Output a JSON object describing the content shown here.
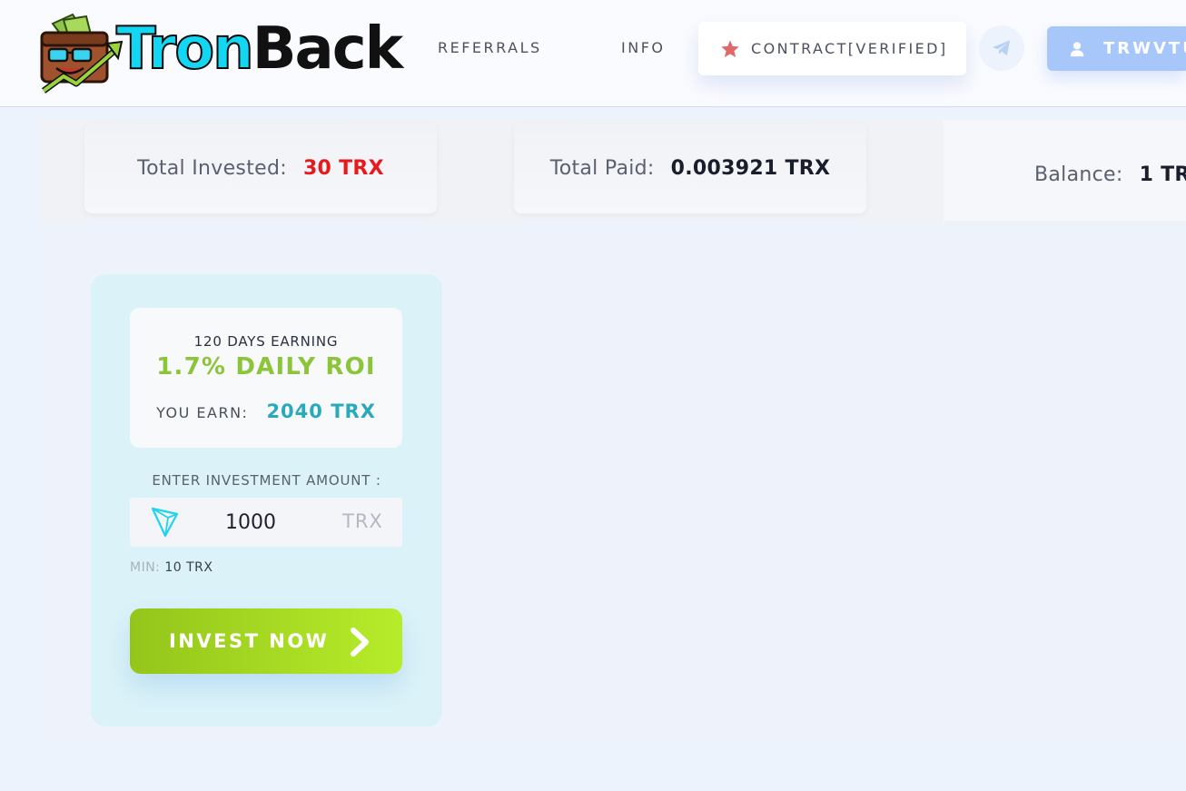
{
  "header": {
    "logo": {
      "part1": "Tron",
      "part2": "Back"
    },
    "nav": {
      "referrals": "REFERRALS",
      "info": "INFO",
      "contract": "CONTRACT[VERIFIED]"
    },
    "account_label": "TRWVTU"
  },
  "stats": {
    "total_invested": {
      "label": "Total Invested:",
      "value": "30 TRX",
      "color": "#e8191d"
    },
    "total_paid": {
      "label": "Total Paid:",
      "value": "0.003921 TRX",
      "color": "#1a1d2b"
    },
    "balance": {
      "label": "Balance:",
      "value": "1 TR",
      "color": "#1a1d2b"
    }
  },
  "plan": {
    "days_label": "120 DAYS EARNING",
    "roi_label": "1.7% DAILY ROI",
    "you_earn_label": "YOU EARN:",
    "you_earn_value": "2040 TRX",
    "enter_label": "ENTER INVESTMENT AMOUNT :",
    "amount_value": "1000",
    "amount_unit": "TRX",
    "min_label": "MIN:",
    "min_value": "10 TRX",
    "invest_button": "INVEST NOW"
  },
  "colors": {
    "accent_cyan": "#13d6f2",
    "roi_green": "#8cc43a",
    "earn_teal": "#28a9bc",
    "button_green": "#a3d621",
    "account_blue": "#a7c7fb",
    "star_red": "#e06868"
  },
  "icons": {
    "logo": "wallet-mascot-icon",
    "contract": "star-icon",
    "telegram": "telegram-icon",
    "account": "user-icon",
    "currency": "tron-icon",
    "invest": "chevron-right-icon"
  }
}
